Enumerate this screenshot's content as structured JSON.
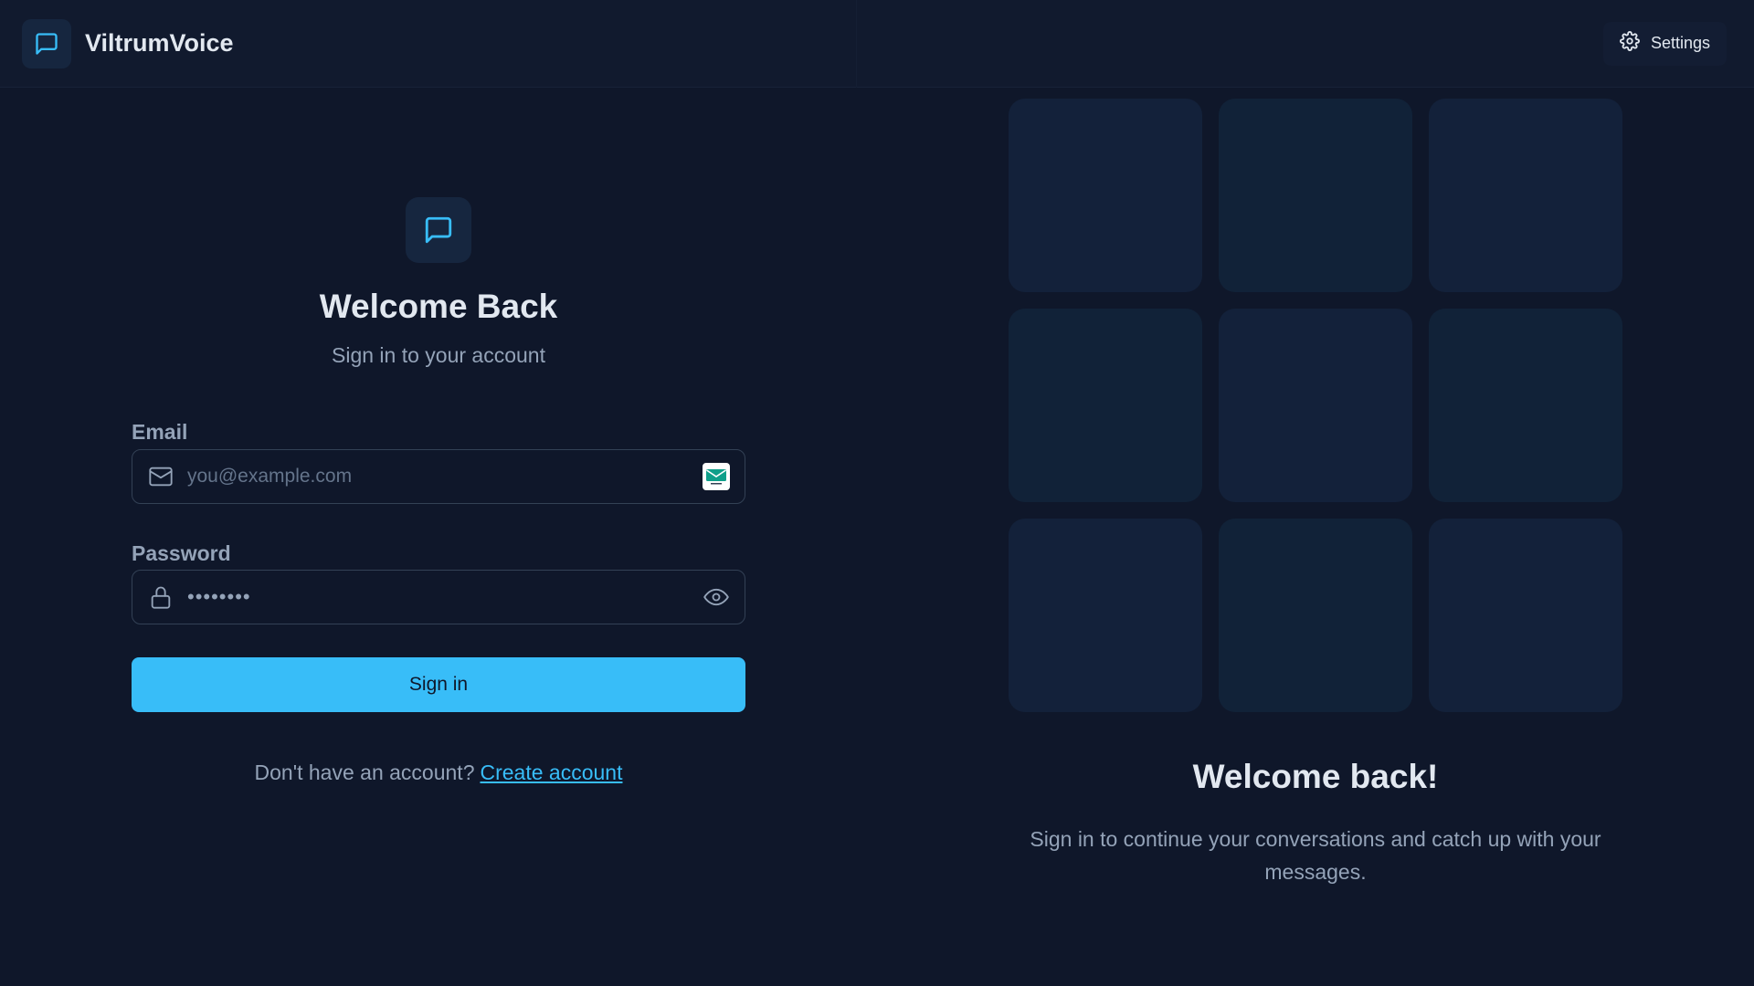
{
  "app": {
    "name": "ViltrumVoice",
    "accent_color": "#38bdf8",
    "background_color": "#0f172a"
  },
  "header": {
    "logo_icon": "message-square-icon",
    "settings_label": "Settings",
    "settings_icon": "gear-icon"
  },
  "login": {
    "hero_icon": "message-square-icon",
    "title": "Welcome Back",
    "subtitle": "Sign in to your account",
    "email": {
      "label": "Email",
      "placeholder": "you@example.com",
      "value": "",
      "icon": "mail-icon",
      "autofill_icon": "autofill-extension-icon"
    },
    "password": {
      "label": "Password",
      "value": "••••••••",
      "icon": "lock-icon",
      "toggle_icon": "eye-icon"
    },
    "submit_label": "Sign in",
    "footer_prompt": "Don't have an account?",
    "footer_link": "Create account"
  },
  "promo": {
    "title": "Welcome back!",
    "text": "Sign in to continue your conversations and catch up with your messages.",
    "tiles": 9
  }
}
